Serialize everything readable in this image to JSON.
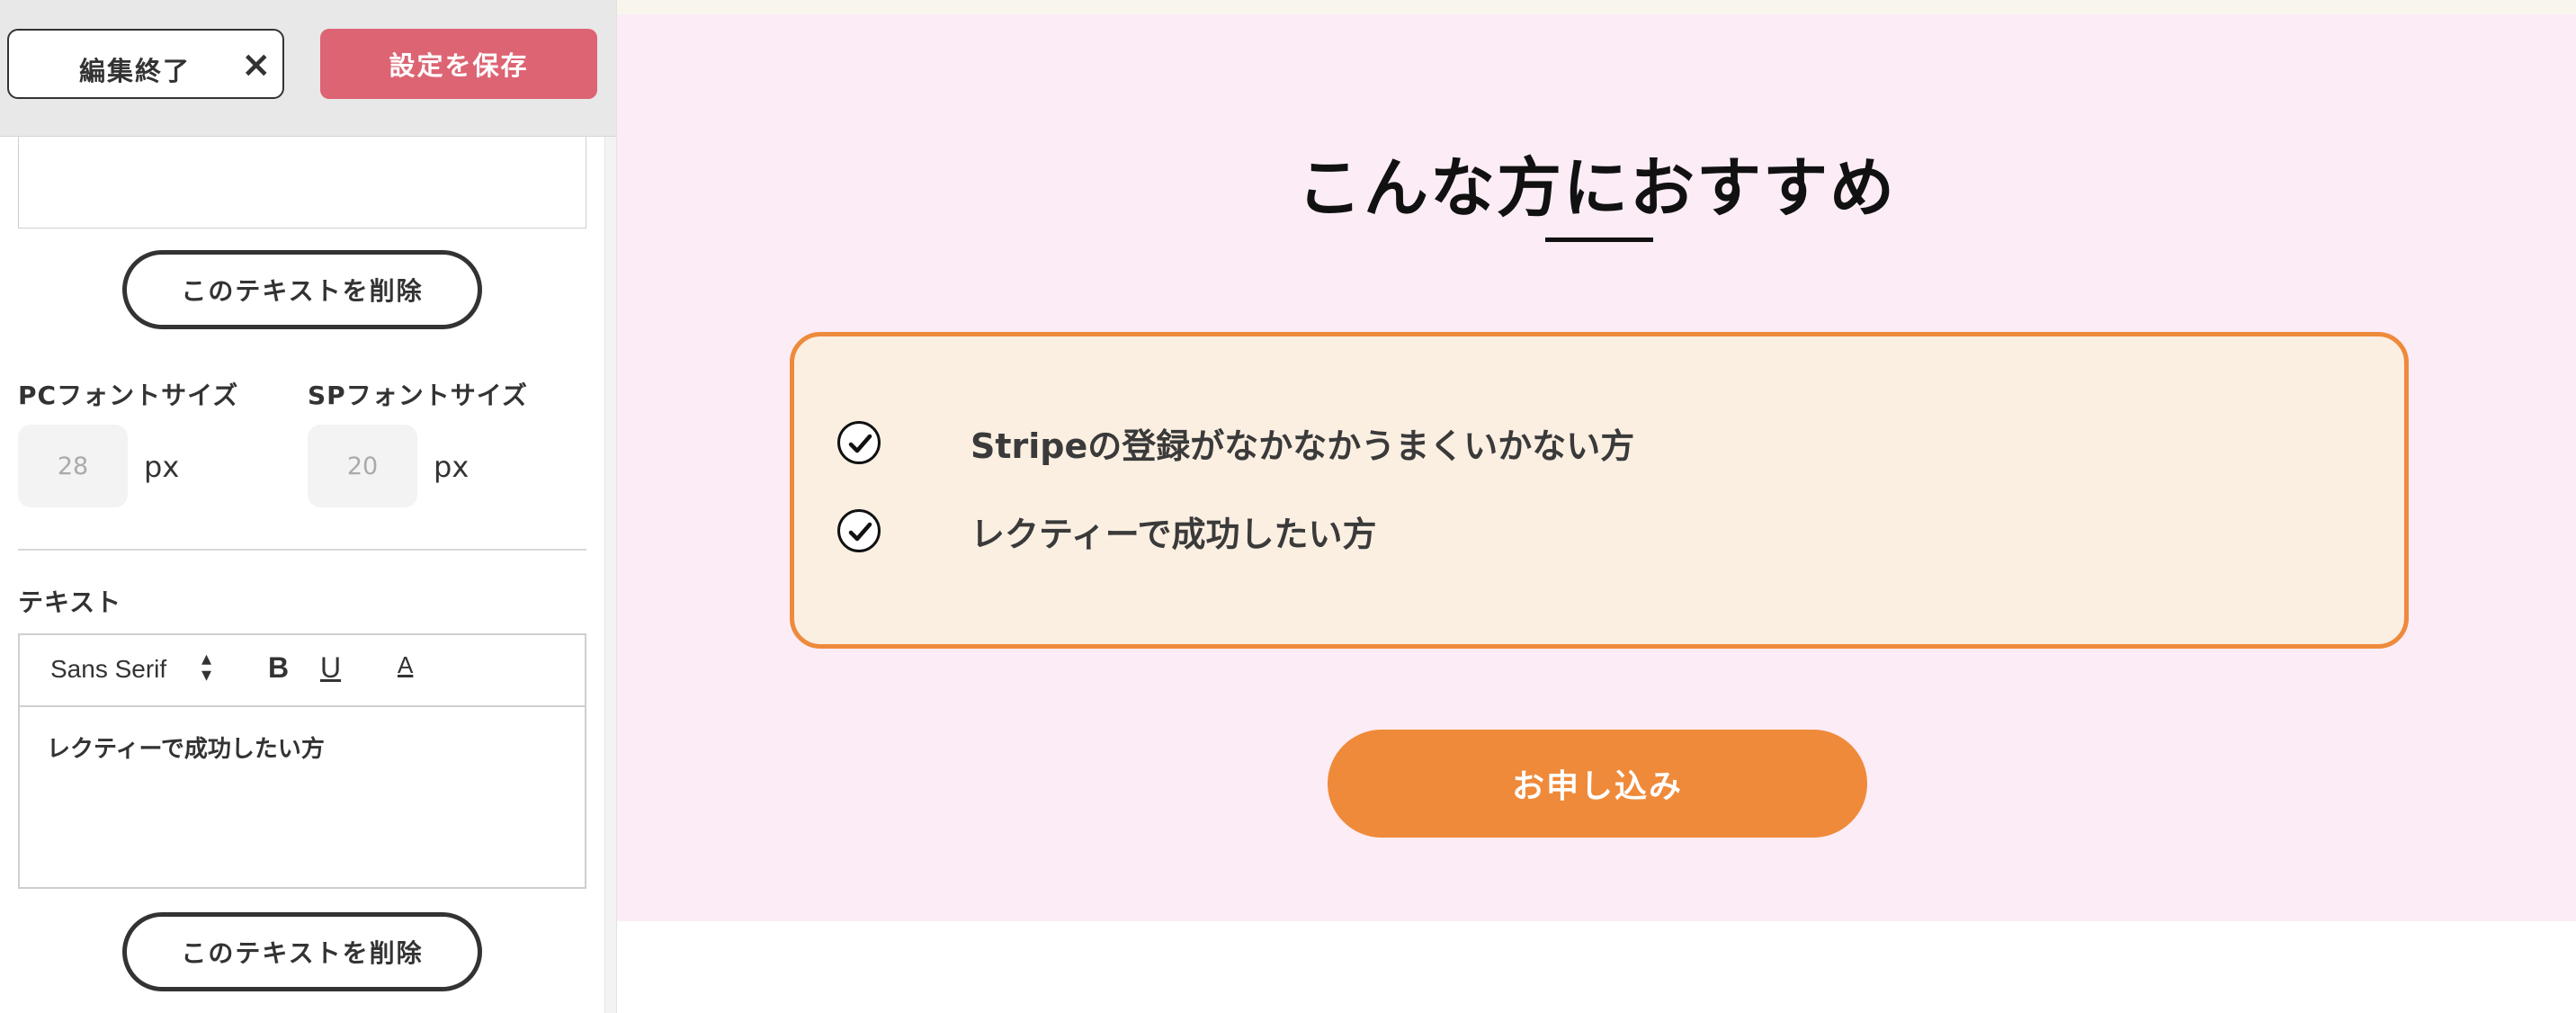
{
  "editor": {
    "close_label": "編集終了",
    "close_icon": "×",
    "save_label": "設定を保存",
    "delete_text_label": "このテキストを削除",
    "pc_font_size_label": "PCフォントサイズ",
    "pc_font_size_value": "28",
    "sp_font_size_label": "SPフォントサイズ",
    "sp_font_size_value": "20",
    "unit": "px",
    "text_label": "テキスト",
    "toolbar": {
      "font_family": "Sans Serif",
      "bold": "B",
      "underline": "U",
      "color": "A"
    },
    "text_content": "レクティーで成功したい方"
  },
  "preview": {
    "heading": "こんな方におすすめ",
    "items": [
      "Stripeの登録がなかなかうまくいかない方",
      "レクティーで成功したい方"
    ],
    "apply_label": "お申し込み"
  },
  "colors": {
    "save_button": "#dd6473",
    "section_bg": "#fbecf6",
    "card_bg": "#fbefe2",
    "accent_orange": "#ee8a3b"
  }
}
